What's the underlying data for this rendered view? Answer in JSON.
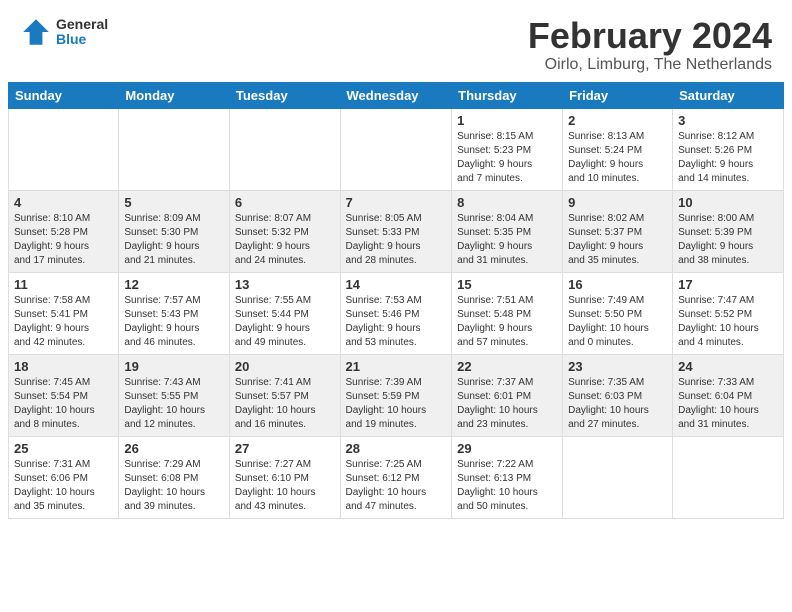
{
  "header": {
    "logo_general": "General",
    "logo_blue": "Blue",
    "month": "February 2024",
    "location": "Oirlo, Limburg, The Netherlands"
  },
  "weekdays": [
    "Sunday",
    "Monday",
    "Tuesday",
    "Wednesday",
    "Thursday",
    "Friday",
    "Saturday"
  ],
  "weeks": [
    [
      {
        "day": "",
        "info": ""
      },
      {
        "day": "",
        "info": ""
      },
      {
        "day": "",
        "info": ""
      },
      {
        "day": "",
        "info": ""
      },
      {
        "day": "1",
        "info": "Sunrise: 8:15 AM\nSunset: 5:23 PM\nDaylight: 9 hours\nand 7 minutes."
      },
      {
        "day": "2",
        "info": "Sunrise: 8:13 AM\nSunset: 5:24 PM\nDaylight: 9 hours\nand 10 minutes."
      },
      {
        "day": "3",
        "info": "Sunrise: 8:12 AM\nSunset: 5:26 PM\nDaylight: 9 hours\nand 14 minutes."
      }
    ],
    [
      {
        "day": "4",
        "info": "Sunrise: 8:10 AM\nSunset: 5:28 PM\nDaylight: 9 hours\nand 17 minutes."
      },
      {
        "day": "5",
        "info": "Sunrise: 8:09 AM\nSunset: 5:30 PM\nDaylight: 9 hours\nand 21 minutes."
      },
      {
        "day": "6",
        "info": "Sunrise: 8:07 AM\nSunset: 5:32 PM\nDaylight: 9 hours\nand 24 minutes."
      },
      {
        "day": "7",
        "info": "Sunrise: 8:05 AM\nSunset: 5:33 PM\nDaylight: 9 hours\nand 28 minutes."
      },
      {
        "day": "8",
        "info": "Sunrise: 8:04 AM\nSunset: 5:35 PM\nDaylight: 9 hours\nand 31 minutes."
      },
      {
        "day": "9",
        "info": "Sunrise: 8:02 AM\nSunset: 5:37 PM\nDaylight: 9 hours\nand 35 minutes."
      },
      {
        "day": "10",
        "info": "Sunrise: 8:00 AM\nSunset: 5:39 PM\nDaylight: 9 hours\nand 38 minutes."
      }
    ],
    [
      {
        "day": "11",
        "info": "Sunrise: 7:58 AM\nSunset: 5:41 PM\nDaylight: 9 hours\nand 42 minutes."
      },
      {
        "day": "12",
        "info": "Sunrise: 7:57 AM\nSunset: 5:43 PM\nDaylight: 9 hours\nand 46 minutes."
      },
      {
        "day": "13",
        "info": "Sunrise: 7:55 AM\nSunset: 5:44 PM\nDaylight: 9 hours\nand 49 minutes."
      },
      {
        "day": "14",
        "info": "Sunrise: 7:53 AM\nSunset: 5:46 PM\nDaylight: 9 hours\nand 53 minutes."
      },
      {
        "day": "15",
        "info": "Sunrise: 7:51 AM\nSunset: 5:48 PM\nDaylight: 9 hours\nand 57 minutes."
      },
      {
        "day": "16",
        "info": "Sunrise: 7:49 AM\nSunset: 5:50 PM\nDaylight: 10 hours\nand 0 minutes."
      },
      {
        "day": "17",
        "info": "Sunrise: 7:47 AM\nSunset: 5:52 PM\nDaylight: 10 hours\nand 4 minutes."
      }
    ],
    [
      {
        "day": "18",
        "info": "Sunrise: 7:45 AM\nSunset: 5:54 PM\nDaylight: 10 hours\nand 8 minutes."
      },
      {
        "day": "19",
        "info": "Sunrise: 7:43 AM\nSunset: 5:55 PM\nDaylight: 10 hours\nand 12 minutes."
      },
      {
        "day": "20",
        "info": "Sunrise: 7:41 AM\nSunset: 5:57 PM\nDaylight: 10 hours\nand 16 minutes."
      },
      {
        "day": "21",
        "info": "Sunrise: 7:39 AM\nSunset: 5:59 PM\nDaylight: 10 hours\nand 19 minutes."
      },
      {
        "day": "22",
        "info": "Sunrise: 7:37 AM\nSunset: 6:01 PM\nDaylight: 10 hours\nand 23 minutes."
      },
      {
        "day": "23",
        "info": "Sunrise: 7:35 AM\nSunset: 6:03 PM\nDaylight: 10 hours\nand 27 minutes."
      },
      {
        "day": "24",
        "info": "Sunrise: 7:33 AM\nSunset: 6:04 PM\nDaylight: 10 hours\nand 31 minutes."
      }
    ],
    [
      {
        "day": "25",
        "info": "Sunrise: 7:31 AM\nSunset: 6:06 PM\nDaylight: 10 hours\nand 35 minutes."
      },
      {
        "day": "26",
        "info": "Sunrise: 7:29 AM\nSunset: 6:08 PM\nDaylight: 10 hours\nand 39 minutes."
      },
      {
        "day": "27",
        "info": "Sunrise: 7:27 AM\nSunset: 6:10 PM\nDaylight: 10 hours\nand 43 minutes."
      },
      {
        "day": "28",
        "info": "Sunrise: 7:25 AM\nSunset: 6:12 PM\nDaylight: 10 hours\nand 47 minutes."
      },
      {
        "day": "29",
        "info": "Sunrise: 7:22 AM\nSunset: 6:13 PM\nDaylight: 10 hours\nand 50 minutes."
      },
      {
        "day": "",
        "info": ""
      },
      {
        "day": "",
        "info": ""
      }
    ]
  ]
}
